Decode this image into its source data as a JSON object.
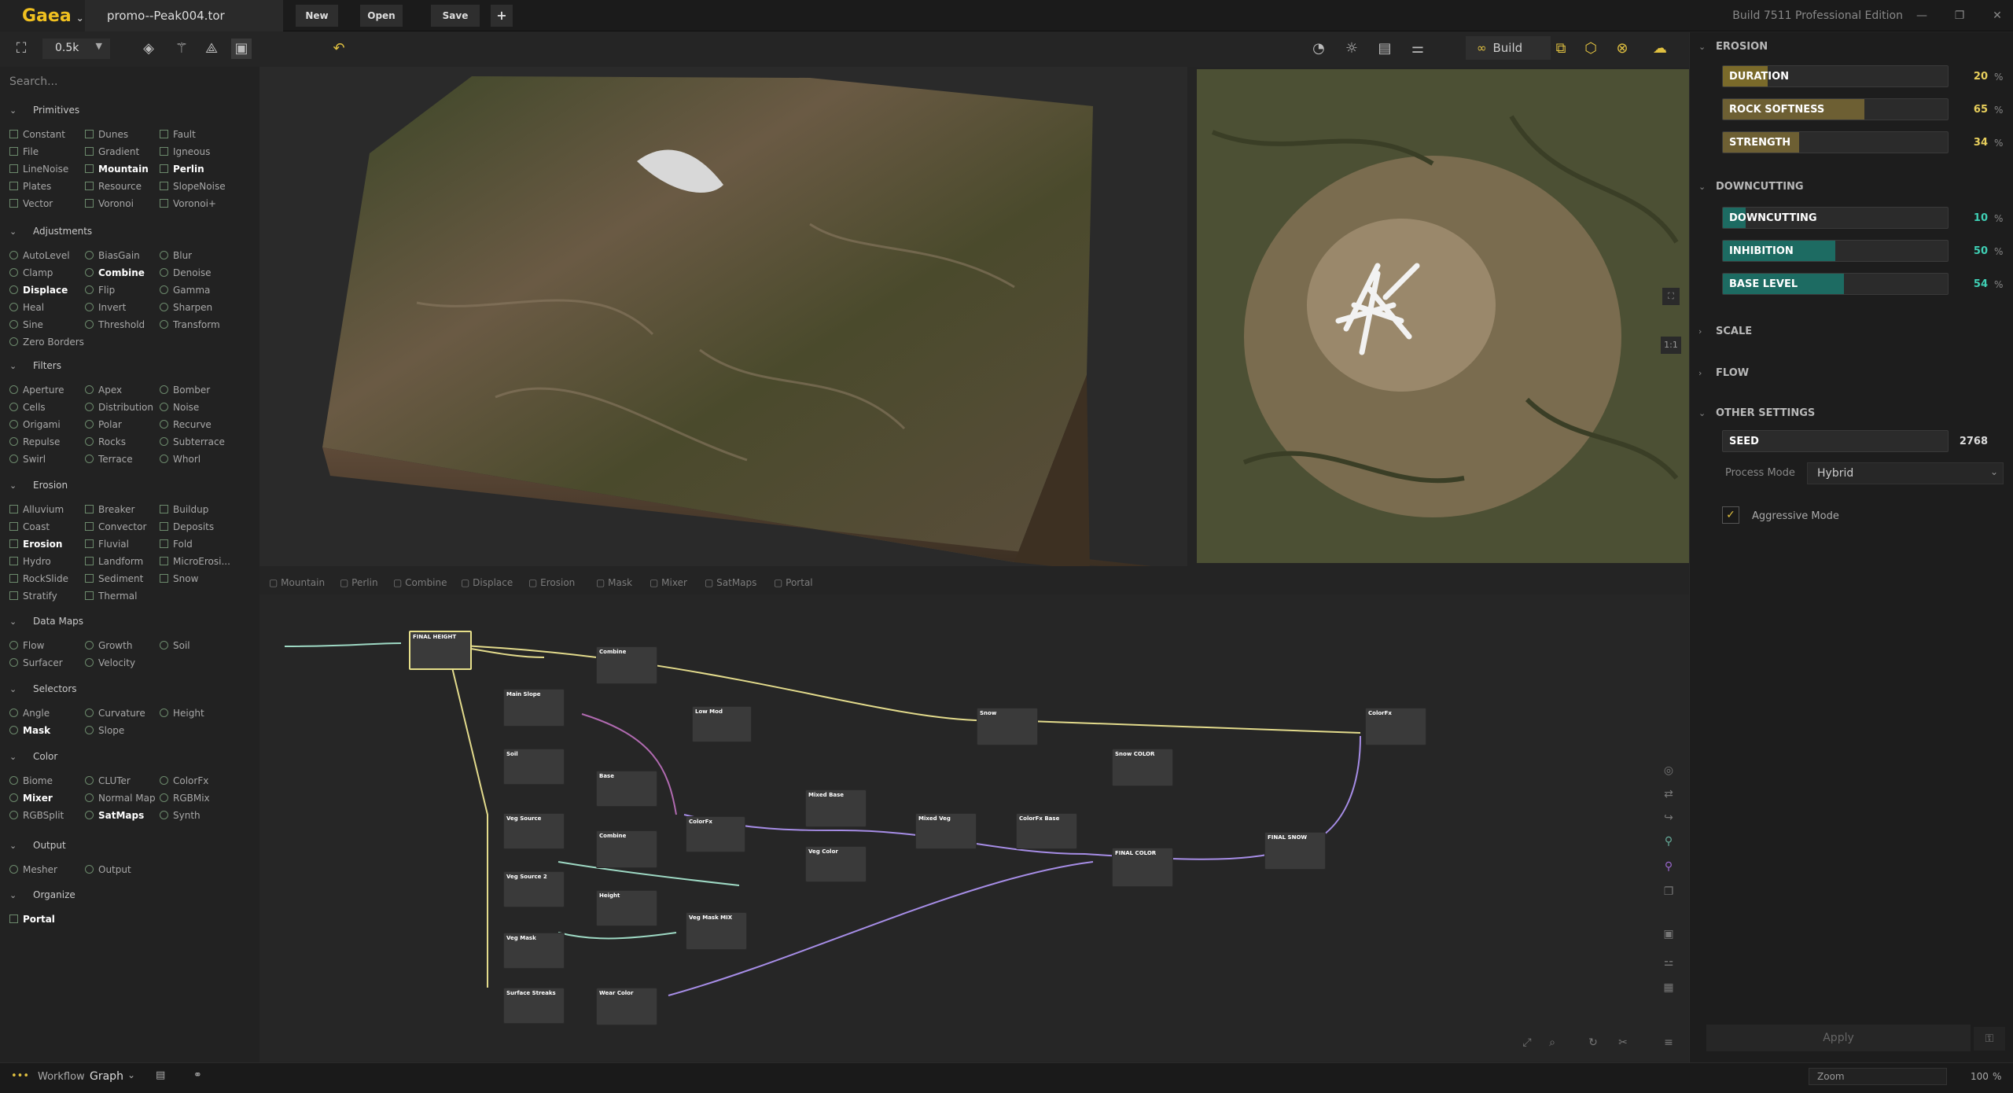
{
  "titlebar": {
    "logo": "Gaea",
    "file_tab": "promo--Peak004.tor",
    "new": "New",
    "open": "Open",
    "save": "Save",
    "plus": "+",
    "build_info": "Build 7511 Professional Edition"
  },
  "toolbar": {
    "zoom_value": "0.5k",
    "build_label": "Build"
  },
  "sidebar": {
    "search_placeholder": "Search...",
    "categories": [
      {
        "label": "Primitives",
        "items": [
          "Constant",
          "Dunes",
          "Fault",
          "File",
          "Gradient",
          "Igneous",
          "LineNoise",
          "Mountain",
          "Perlin",
          "Plates",
          "Resource",
          "SlopeNoise",
          "Vector",
          "Voronoi",
          "Voronoi+"
        ]
      },
      {
        "label": "Adjustments",
        "items": [
          "AutoLevel",
          "BiasGain",
          "Blur",
          "Clamp",
          "Combine",
          "Denoise",
          "Displace",
          "Flip",
          "Gamma",
          "Heal",
          "Invert",
          "Sharpen",
          "Sine",
          "Threshold",
          "Transform",
          "Zero Borders"
        ]
      },
      {
        "label": "Filters",
        "items": [
          "Aperture",
          "Apex",
          "Bomber",
          "Cells",
          "Distribution",
          "Noise",
          "Origami",
          "Polar",
          "Recurve",
          "Repulse",
          "Rocks",
          "Subterrace",
          "Swirl",
          "Terrace",
          "Whorl"
        ]
      },
      {
        "label": "Erosion",
        "items": [
          "Alluvium",
          "Breaker",
          "Buildup",
          "Coast",
          "Convector",
          "Deposits",
          "Erosion",
          "Fluvial",
          "Fold",
          "Hydro",
          "Landform",
          "MicroErosi...",
          "RockSlide",
          "Sediment",
          "Snow",
          "Stratify",
          "Thermal"
        ]
      },
      {
        "label": "Data Maps",
        "items": [
          "Flow",
          "Growth",
          "Soil",
          "Surfacer",
          "Velocity"
        ]
      },
      {
        "label": "Selectors",
        "items": [
          "Angle",
          "Curvature",
          "Height",
          "Mask",
          "Slope"
        ]
      },
      {
        "label": "Color",
        "items": [
          "Biome",
          "CLUTer",
          "ColorFx",
          "Mixer",
          "Normal Map",
          "RGBMix",
          "RGBSplit",
          "SatMaps",
          "Synth"
        ]
      },
      {
        "label": "Output",
        "items": [
          "Mesher",
          "Output"
        ]
      },
      {
        "label": "Organize",
        "items": [
          "Portal"
        ]
      }
    ]
  },
  "nodebar": [
    "Mountain",
    "Perlin",
    "Combine",
    "Displace",
    "Erosion",
    "Mask",
    "Mixer",
    "SatMaps",
    "Portal"
  ],
  "viewport": {
    "side_labels": [
      "1:1"
    ]
  },
  "graph_nodes": [
    {
      "title": "FINAL HEIGHT"
    },
    {
      "title": "Combine"
    },
    {
      "title": "Main Slope"
    },
    {
      "title": "Low Mod"
    },
    {
      "title": "Snow"
    },
    {
      "title": "ColorFx"
    },
    {
      "title": "Soil"
    },
    {
      "title": "Base"
    },
    {
      "title": "Snow COLOR"
    },
    {
      "title": "Mixed Base"
    },
    {
      "title": "ColorFx"
    },
    {
      "title": "Veg Source"
    },
    {
      "title": "Combine"
    },
    {
      "title": "Veg Color"
    },
    {
      "title": "Mixed Veg"
    },
    {
      "title": "ColorFx Base"
    },
    {
      "title": "FINAL COLOR"
    },
    {
      "title": "FINAL SNOW"
    },
    {
      "title": "Veg Source 2"
    },
    {
      "title": "Height"
    },
    {
      "title": "Veg Mask MIX"
    },
    {
      "title": "Veg Mask"
    },
    {
      "title": "Surface Streaks"
    },
    {
      "title": "Wear Color"
    }
  ],
  "rpanel": {
    "sections": {
      "erosion": "EROSION",
      "downcutting": "DOWNCUTTING",
      "scale": "SCALE",
      "flow": "FLOW",
      "other": "OTHER SETTINGS"
    },
    "sliders": [
      {
        "label": "DURATION",
        "value": "20",
        "fill": 0.2,
        "color": "#7a6a2a"
      },
      {
        "label": "ROCK SOFTNESS",
        "value": "65",
        "fill": 0.63,
        "color": "#6d5f33"
      },
      {
        "label": "STRENGTH",
        "value": "34",
        "fill": 0.34,
        "color": "#6d5f33"
      },
      {
        "label": "DOWNCUTTING",
        "value": "10",
        "fill": 0.1,
        "color": "#1d6b62"
      },
      {
        "label": "INHIBITION",
        "value": "50",
        "fill": 0.5,
        "color": "#1d6b62"
      },
      {
        "label": "BASE LEVEL",
        "value": "54",
        "fill": 0.54,
        "color": "#1d6b62"
      }
    ],
    "percent": "%",
    "seed_label": "SEED",
    "seed_value": "2768",
    "process_mode_label": "Process Mode",
    "process_mode_value": "Hybrid",
    "aggressive_label": "Aggressive Mode",
    "apply": "Apply"
  },
  "status": {
    "workflow": "Workflow",
    "graph": "Graph",
    "zoom_placeholder": "Zoom",
    "zoom_value": "100",
    "zoom_unit": "%"
  }
}
